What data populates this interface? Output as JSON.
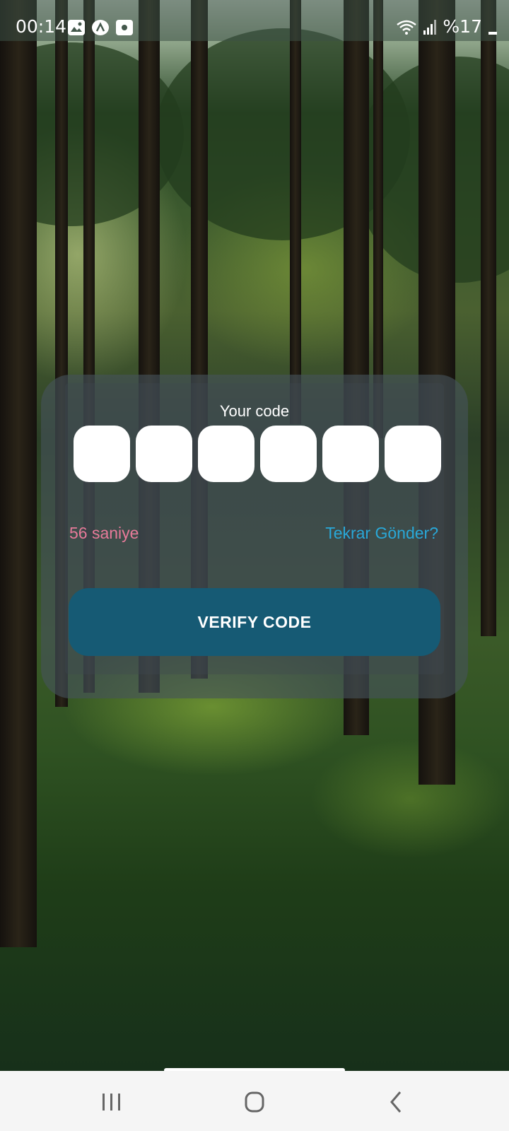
{
  "status_bar": {
    "time": "00:14",
    "battery": "%17",
    "left_icons": [
      "image-icon",
      "app-icon",
      "recorder-icon"
    ],
    "right_icons": [
      "wifi-icon",
      "signal-icon",
      "battery-icon"
    ]
  },
  "card": {
    "label": "Your code",
    "code_digits": [
      "",
      "",
      "",
      "",
      "",
      ""
    ],
    "timer": "56 saniye",
    "resend": "Tekrar Gönder?",
    "verify_button": "VERIFY CODE"
  },
  "colors": {
    "timer": "#e77a9a",
    "resend": "#29a8d8",
    "button": "#165a74"
  },
  "nav_bar": {
    "buttons": [
      "recents-icon",
      "home-icon",
      "back-icon"
    ]
  }
}
